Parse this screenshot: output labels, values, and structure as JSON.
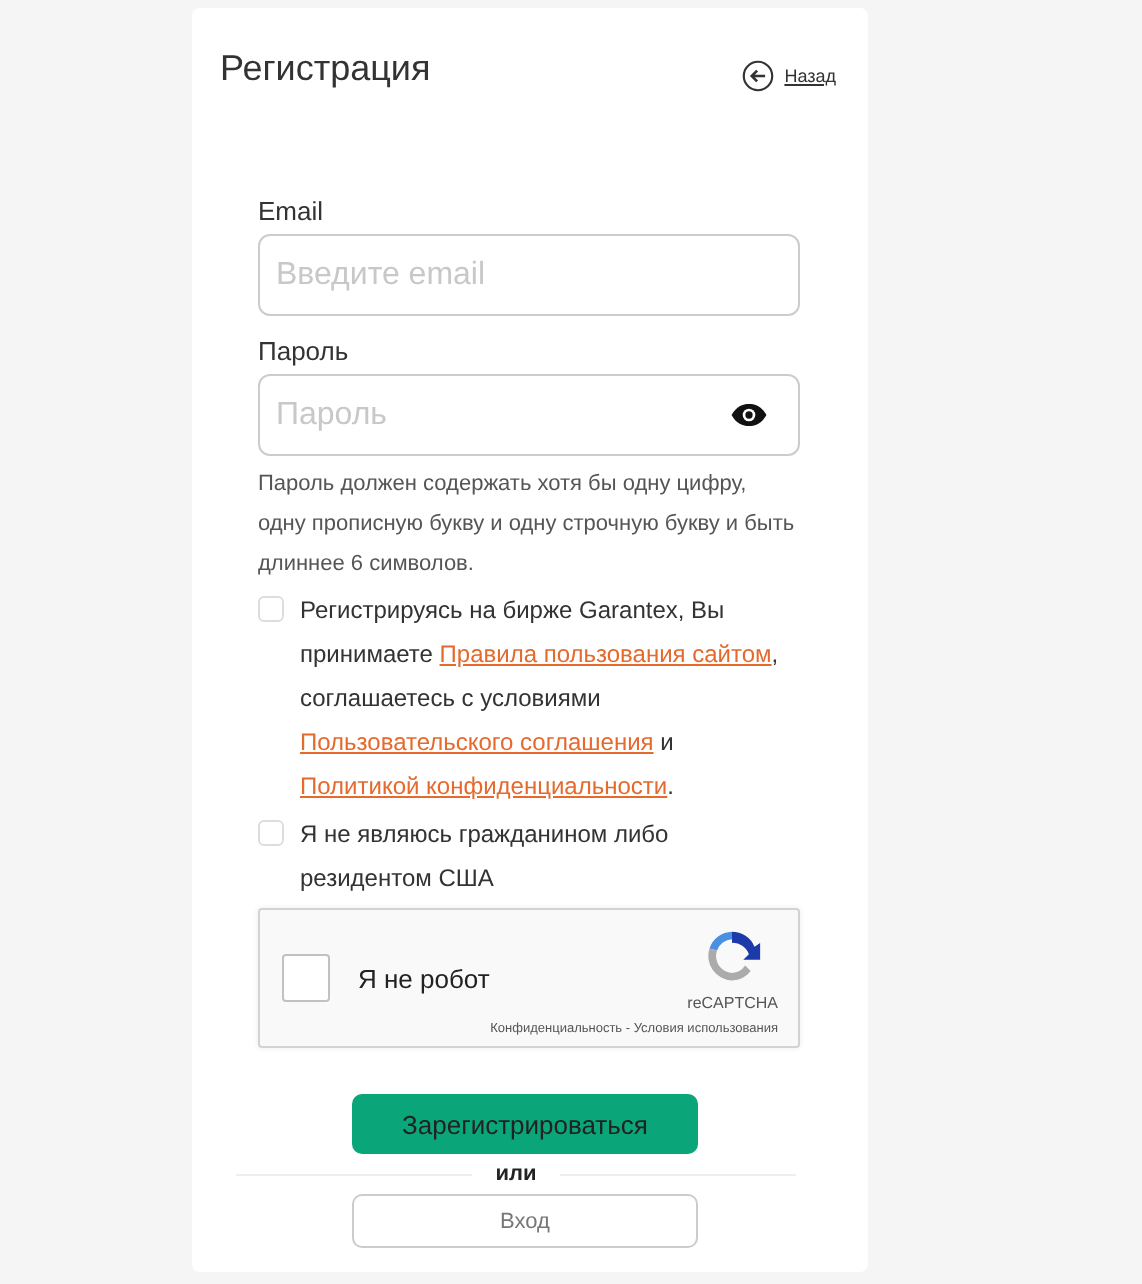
{
  "title": "Регистрация",
  "back_link": {
    "label": "Назад"
  },
  "email": {
    "label": "Email",
    "placeholder": "Введите email"
  },
  "password": {
    "label": "Пароль",
    "placeholder": "Пароль",
    "hint": "Пароль должен содержать хотя бы одну цифру, одну прописную букву и одну строчную букву и быть длиннее 6 символов."
  },
  "agreement": {
    "checked": false,
    "parts": [
      {
        "kind": "text",
        "text": "Регистрируясь на бирже Garantex, Вы принимаете "
      },
      {
        "kind": "link",
        "text": "Правила пользования сайтом"
      },
      {
        "kind": "text",
        "text": ", соглашаетесь с условиями "
      },
      {
        "kind": "link",
        "text": "Пользовательского соглашения"
      },
      {
        "kind": "text",
        "text": " и "
      },
      {
        "kind": "link",
        "text": "Политикой конфиденциальности"
      },
      {
        "kind": "text",
        "text": "."
      }
    ]
  },
  "not_us": {
    "checked": false,
    "label": "Я не являюсь гражданином либо резидентом США"
  },
  "captcha": {
    "checked": false,
    "label": "Я не робот",
    "brand": "reCAPTCHA",
    "terms": "Конфиденциальность - Условия использования"
  },
  "register_button": "Зарегистрироваться",
  "divider": "или",
  "login_button": "Вход"
}
